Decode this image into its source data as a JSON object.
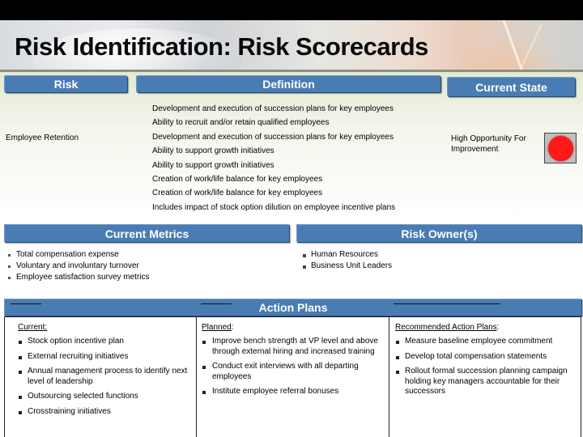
{
  "slide": {
    "title": "Risk Identification:  Risk Scorecards"
  },
  "scorecard": {
    "headers": {
      "risk": "Risk",
      "definition": "Definition",
      "current_state": "Current State"
    },
    "risk_name": "Employee Retention",
    "definitions": [
      "Development and execution of succession plans for key employees",
      "Ability to recruit and/or retain qualified employees",
      "Development and execution of succession plans for key employees",
      "Ability to support growth initiatives",
      "Ability to support growth initiatives",
      "Creation of work/life balance for key employees",
      "Creation of work/life balance for key employees",
      "Includes impact of stock option dilution on employee incentive plans"
    ],
    "current_state": {
      "text": "High Opportunity For Improvement",
      "indicator": "red-circle",
      "indicator_color": "#ff1a1a"
    }
  },
  "metrics": {
    "header": "Current Metrics",
    "items": [
      "Total compensation expense",
      "Voluntary and involuntary turnover",
      "Employee satisfaction survey metrics"
    ]
  },
  "owners": {
    "header": "Risk Owner(s)",
    "items": [
      "Human Resources",
      "Business Unit Leaders"
    ]
  },
  "action_plans": {
    "header": "Action Plans",
    "columns": {
      "current": {
        "label": "Current:",
        "items": [
          "Stock option incentive plan",
          "External recruiting initiatives",
          "Annual management process to identify next level of leadership",
          "Outsourcing selected functions",
          "Crosstraining initiatives"
        ]
      },
      "planned": {
        "label": "Planned",
        "suffix": ":",
        "items": [
          "Improve bench strength at VP level and above through external hiring and increased training",
          "Conduct exit interviews with all departing employees",
          "Institute employee referral bonuses"
        ]
      },
      "recommended": {
        "label": "Recommended Action Plans",
        "suffix": ":",
        "items": [
          "Measure baseline employee commitment",
          "Develop total compensation statements",
          "Rollout formal succession planning campaign holding key  managers accountable for their successors"
        ]
      }
    }
  },
  "colors": {
    "header_blue": "#4a7cb4",
    "top_bar": "#000000"
  }
}
